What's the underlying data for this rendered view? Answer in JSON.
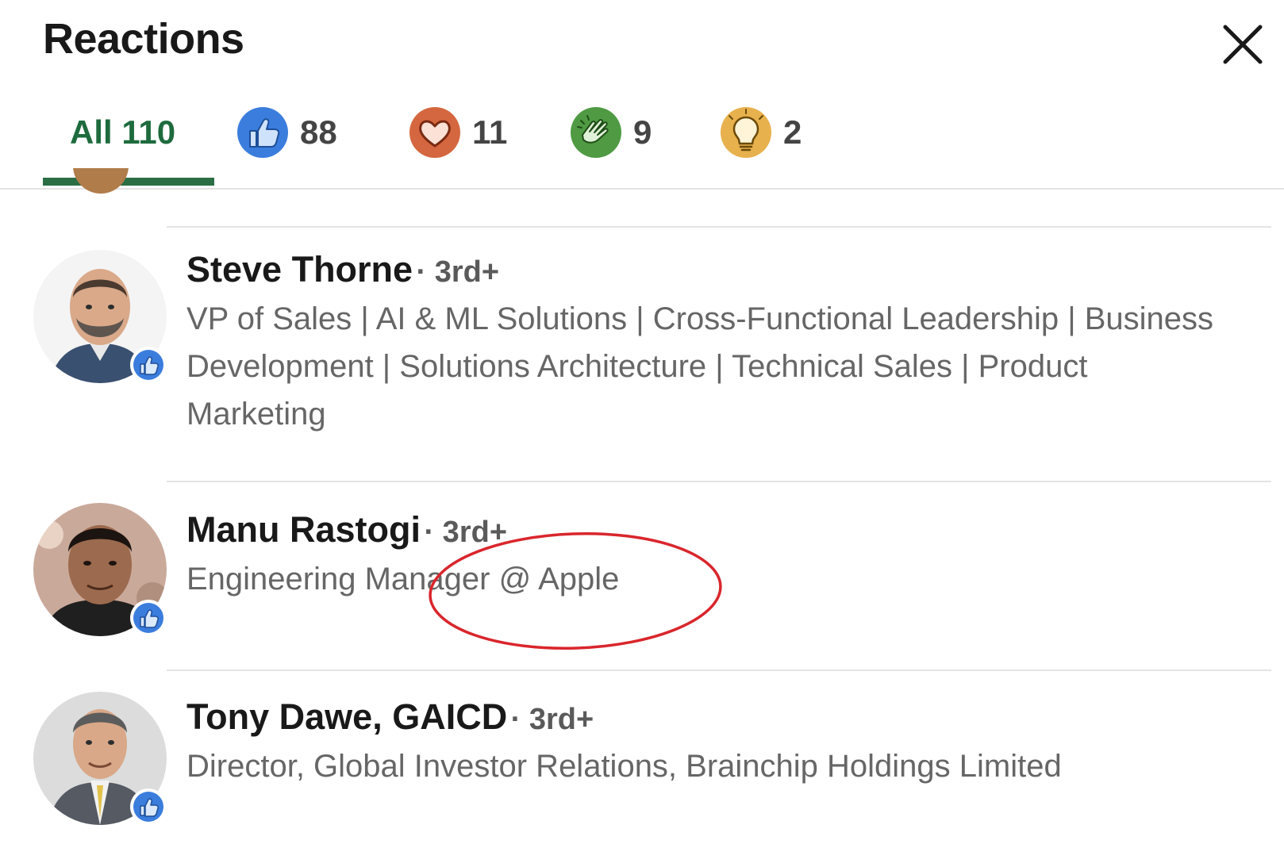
{
  "header": {
    "title": "Reactions",
    "close_icon": "close-icon"
  },
  "tabs": [
    {
      "label": "All 110",
      "icon": null,
      "active": true
    },
    {
      "count": "88",
      "icon": "like-icon",
      "color": "#3b7ddd"
    },
    {
      "count": "11",
      "icon": "love-icon",
      "color": "#d4673f"
    },
    {
      "count": "9",
      "icon": "celebrate-icon",
      "color": "#4f9a43"
    },
    {
      "count": "2",
      "icon": "insightful-icon",
      "color": "#e7b14d"
    }
  ],
  "people": [
    {
      "name": "Steve Thorne",
      "degree": "· 3rd+",
      "headline": "VP of Sales | AI & ML Solutions | Cross-Functional Leadership | Business Development | Solutions Architecture | Technical Sales | Product Marketing",
      "reaction_icon": "like-icon"
    },
    {
      "name": "Manu Rastogi",
      "degree": "· 3rd+",
      "headline": "Engineering Manager @ Apple",
      "reaction_icon": "like-icon"
    },
    {
      "name": "Tony Dawe, GAICD",
      "degree": "· 3rd+",
      "headline": "Director, Global Investor Relations, Brainchip Holdings Limited",
      "reaction_icon": "like-icon"
    }
  ],
  "colors": {
    "accent": "#2b6e45",
    "like_blue": "#3b7ddd",
    "annotation_red": "#d9262c"
  }
}
